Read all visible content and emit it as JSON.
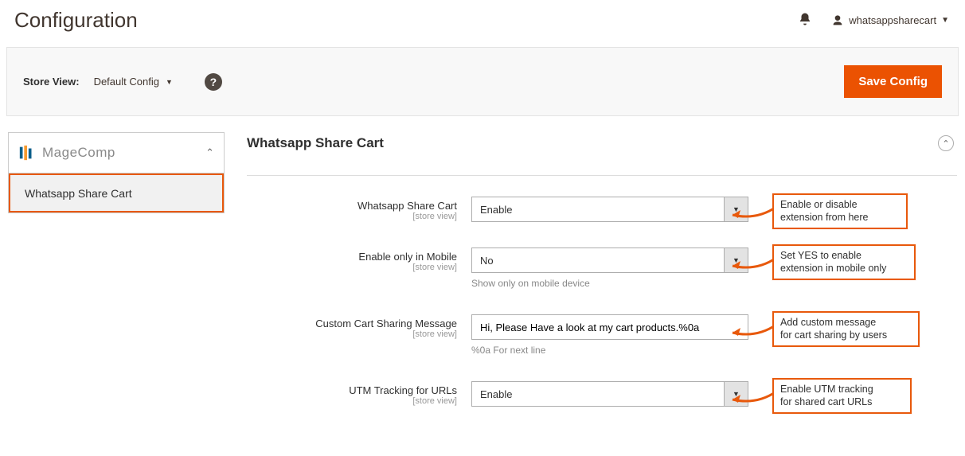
{
  "page_title": "Configuration",
  "user": "whatsappsharecart",
  "toolbar": {
    "store_view_label": "Store View:",
    "store_view_value": "Default Config",
    "save_label": "Save Config"
  },
  "sidebar": {
    "brand": "MageComp",
    "items": [
      "Whatsapp Share Cart"
    ]
  },
  "section": {
    "title": "Whatsapp Share Cart"
  },
  "fields": {
    "enable": {
      "label": "Whatsapp Share Cart",
      "scope": "[store view]",
      "value": "Enable"
    },
    "mobile_only": {
      "label": "Enable only in Mobile",
      "scope": "[store view]",
      "value": "No",
      "note": "Show only on mobile device"
    },
    "message": {
      "label": "Custom Cart Sharing Message",
      "scope": "[store view]",
      "value": "Hi, Please Have a look at my cart products.%0a",
      "note": "%0a For next line"
    },
    "utm": {
      "label": "UTM Tracking for URLs",
      "scope": "[store view]",
      "value": "Enable"
    }
  },
  "callouts": {
    "enable": "Enable or disable\nextension from here",
    "mobile": "Set YES to enable\nextension in mobile only",
    "message": "Add custom message\nfor cart sharing by users",
    "utm": "Enable UTM tracking\nfor shared cart URLs"
  }
}
